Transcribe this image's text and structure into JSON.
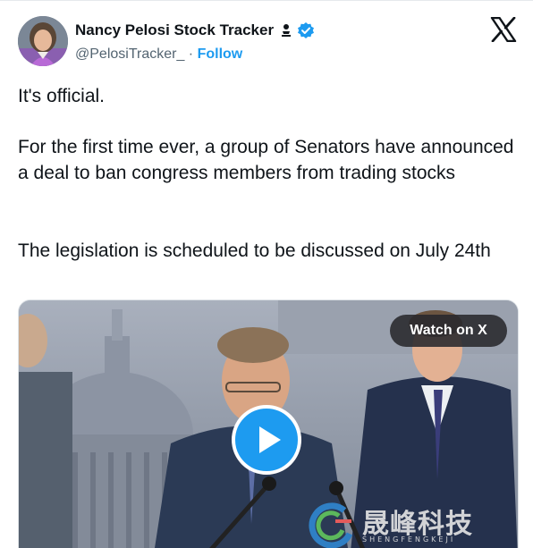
{
  "author": {
    "name": "Nancy Pelosi Stock Tracker",
    "handle": "@PelosiTracker_",
    "separator": " · ",
    "follow_label": "Follow"
  },
  "icons": {
    "affiliate": "person-badge-icon",
    "verified": "blue-check-icon",
    "platform": "x-logo-icon",
    "play": "play-icon"
  },
  "tweet": {
    "line1": "It's official.",
    "line2": "For the first time ever, a group of Senators have announced a deal to ban congress members from trading stocks",
    "line3": "The legislation is scheduled to be discussed on July 24th"
  },
  "media": {
    "watch_label": "Watch on X"
  },
  "watermark": {
    "title": "晟峰科技",
    "subtitle": "SHENGFENGKEJI"
  },
  "colors": {
    "accent": "#1d9bf0",
    "text": "#0f1419",
    "muted": "#536471"
  }
}
